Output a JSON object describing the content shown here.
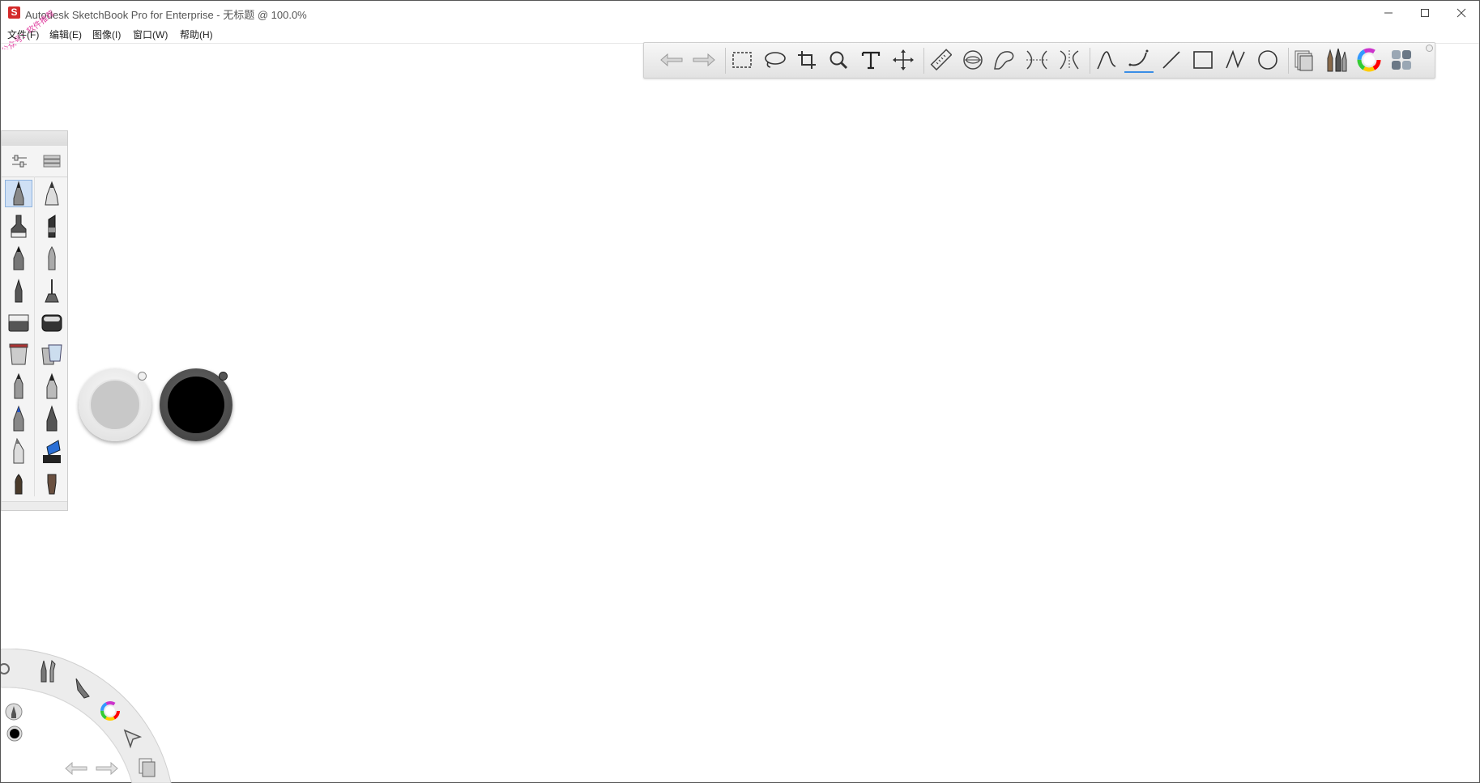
{
  "window": {
    "logo_letter": "S",
    "title": "Autodesk SketchBook Pro for Enterprise - 无标题 @ 100.0%",
    "minimize_icon": "minimize-icon",
    "maximize_icon": "maximize-icon",
    "close_icon": "close-icon"
  },
  "watermark": {
    "text": "公众号：软件推荐"
  },
  "menu": [
    {
      "label": "文件(F)"
    },
    {
      "label": "编辑(E)"
    },
    {
      "label": "图像(I)"
    },
    {
      "label": "窗口(W)"
    },
    {
      "label": "帮助(H)"
    }
  ],
  "toolbar": {
    "groups": [
      [
        "undo-icon",
        "redo-icon"
      ],
      [
        "rect-select-icon",
        "lasso-icon",
        "crop-icon",
        "zoom-icon",
        "text-icon",
        "move-icon"
      ],
      [
        "ruler-icon",
        "ellipse-guide-icon",
        "french-curve-icon",
        "symmetry-x-icon",
        "symmetry-y-icon"
      ],
      [
        "steady-stroke-icon",
        "predictive-stroke-icon",
        "line-icon",
        "rectangle-icon",
        "polyline-icon",
        "ellipse-icon"
      ],
      [
        "layers-icon",
        "brushes-icon",
        "color-wheel-icon",
        "copic-library-icon"
      ]
    ],
    "active_tool": "predictive-stroke-icon",
    "accent": "#3a8ee6"
  },
  "brush_panel": {
    "tools": [
      "brush-properties-icon",
      "brush-library-icon"
    ],
    "selected": "pencil-brush-icon",
    "brushes": [
      "pencil-brush-icon",
      "ballpoint-pen-icon",
      "marker-icon",
      "chisel-marker-icon",
      "ink-pen-icon",
      "paint-brush-icon",
      "fine-pen-icon",
      "airbrush-icon",
      "hard-eraser-icon",
      "soft-eraser-icon",
      "paint-bucket-icon",
      "gradient-fill-icon",
      "felt-pen-icon",
      "calligraphy-pen-icon",
      "blue-pen-icon",
      "technical-pen-icon",
      "highlighter-icon",
      "blue-marker-icon",
      "round-brush-icon",
      "flat-brush-icon"
    ]
  },
  "pucks": {
    "size_opacity": "#c8c8c8",
    "color": "#000000"
  },
  "lagoon": {
    "items": [
      "settings-icon",
      "tools-icon",
      "brush-icon",
      "color-wheel-icon",
      "select-arrow-icon",
      "layers-icon",
      "undo-icon",
      "redo-icon",
      "current-brush-icon",
      "current-color-icon"
    ]
  }
}
